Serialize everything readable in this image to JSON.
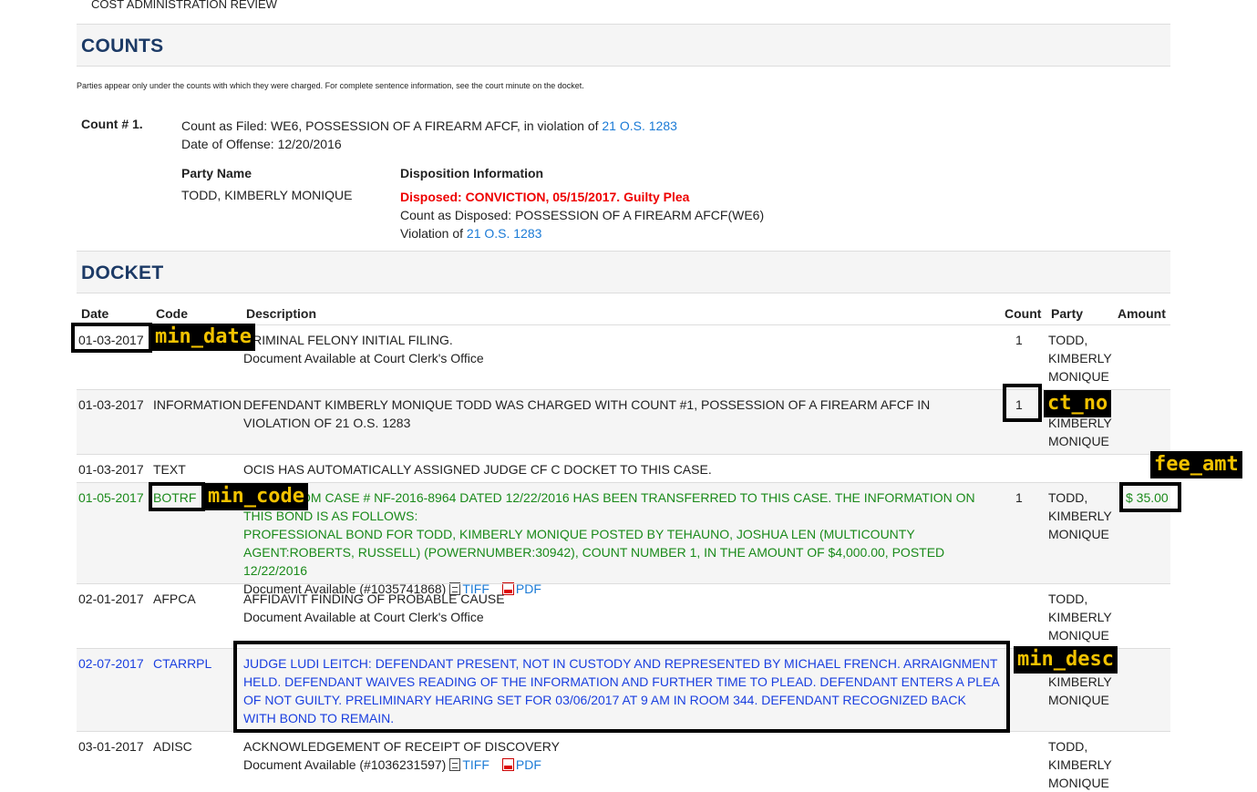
{
  "top": {
    "left_text": "COST ADMINISTRATION REVIEW",
    "right_text": "...,           ...,                ...             ...  (...)"
  },
  "counts": {
    "heading": "COUNTS",
    "note": "Parties appear only under the counts with which they were charged. For complete sentence information, see the court minute on the docket.",
    "count_label": "Count # 1.",
    "filed_prefix": "Count as Filed: WE6, POSSESSION OF A FIREARM AFCF, in violation of ",
    "filed_link": "21 O.S. 1283",
    "offense_date": "Date of Offense: 12/20/2016",
    "party_header": "Party Name",
    "disp_header": "Disposition Information",
    "party_name": "TODD, KIMBERLY MONIQUE",
    "disposed": "Disposed: CONVICTION, 05/15/2017. Guilty Plea",
    "count_disposed": "Count as Disposed: POSSESSION OF A FIREARM AFCF(WE6)",
    "violation_prefix": "Violation of ",
    "violation_link": "21 O.S. 1283"
  },
  "docket": {
    "heading": "DOCKET",
    "headers": {
      "date": "Date",
      "code": "Code",
      "desc": "Description",
      "count": "Count",
      "party": "Party",
      "amount": "Amount"
    },
    "rows": [
      {
        "date": "01-03-2017",
        "code": "",
        "desc": "CRIMINAL FELONY INITIAL FILING.",
        "sub": "Document Available at Court Clerk's Office",
        "count": "1",
        "party": "TODD, KIMBERLY MONIQUE",
        "amount": ""
      },
      {
        "date": "01-03-2017",
        "code": "INFORMATION",
        "desc": "DEFENDANT KIMBERLY MONIQUE TODD WAS CHARGED WITH COUNT #1, POSSESSION OF A FIREARM AFCF IN VIOLATION OF 21 O.S. 1283",
        "sub": "",
        "count": "1",
        "party": "TODD, KIMBERLY MONIQUE",
        "amount": ""
      },
      {
        "date": "01-03-2017",
        "code": "TEXT",
        "desc": "OCIS HAS AUTOMATICALLY ASSIGNED JUDGE CF C DOCKET TO THIS CASE.",
        "sub": "",
        "count": "",
        "party": "",
        "amount": ""
      },
      {
        "date": "01-05-2017",
        "code": "BOTRF",
        "desc": "BOND FROM CASE # NF-2016-8964 DATED 12/22/2016 HAS BEEN TRANSFERRED TO THIS CASE. THE INFORMATION ON THIS BOND IS AS FOLLOWS:",
        "desc2": "PROFESSIONAL BOND FOR TODD, KIMBERLY MONIQUE POSTED BY TEHAUNO, JOSHUA LEN (MULTICOUNTY AGENT:ROBERTS, RUSSELL) (POWERNUMBER:30942), COUNT NUMBER 1, IN THE AMOUNT OF $4,000.00, POSTED 12/22/2016",
        "sub": "Document Available (#1035741868)",
        "count": "1",
        "party": "TODD, KIMBERLY MONIQUE",
        "amount": "$ 35.00"
      },
      {
        "date": "02-01-2017",
        "code": "AFPCA",
        "desc": "AFFIDAVIT FINDING OF PROBABLE CAUSE",
        "sub": "Document Available at Court Clerk's Office",
        "count": "",
        "party": "TODD, KIMBERLY MONIQUE",
        "amount": ""
      },
      {
        "date": "02-07-2017",
        "code": "CTARRPL",
        "desc": "JUDGE LUDI LEITCH: DEFENDANT PRESENT, NOT IN CUSTODY AND REPRESENTED BY MICHAEL FRENCH. ARRAIGNMENT HELD. DEFENDANT WAIVES READING OF THE INFORMATION AND FURTHER TIME TO PLEAD. DEFENDANT ENTERS A PLEA OF NOT GUILTY. PRELIMINARY HEARING SET FOR 03/06/2017 AT 9 AM IN ROOM 344. DEFENDANT RECOGNIZED BACK WITH BOND TO REMAIN.",
        "sub": "",
        "count": "",
        "party": "TODD, KIMBERLY MONIQUE",
        "amount": ""
      },
      {
        "date": "03-01-2017",
        "code": "ADISC",
        "desc": "ACKNOWLEDGEMENT OF RECEIPT OF DISCOVERY",
        "sub": "Document Available (#1036231597)",
        "count": "",
        "party": "TODD, KIMBERLY MONIQUE",
        "amount": ""
      }
    ],
    "links": {
      "tiff": "TIFF",
      "pdf": "PDF"
    }
  },
  "annotations": {
    "min_date": "min_date",
    "min_code": "min_code",
    "ct_no": "ct_no",
    "fee_amt": "fee_amt",
    "min_desc": "min_desc"
  },
  "colors": {
    "heading": "#1c3a66",
    "link": "#1a7ad6",
    "green": "#1a8a1a",
    "blue": "#1a3fe0",
    "red": "#ee0000",
    "tag_text": "#f2c200"
  }
}
